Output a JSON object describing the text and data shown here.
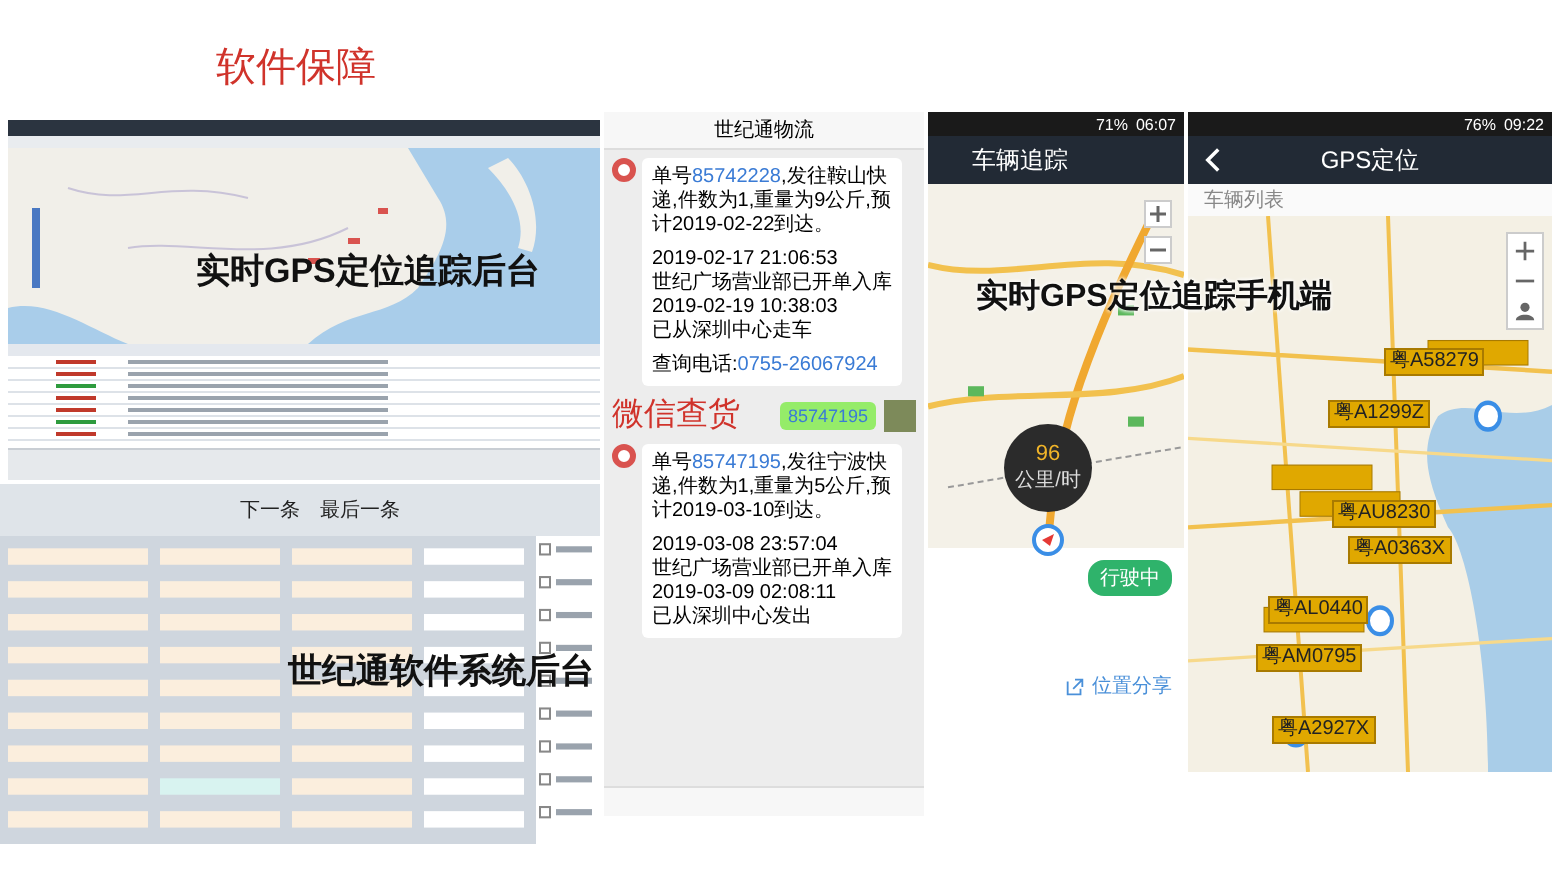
{
  "title": "软件保障",
  "gps_backend": {
    "caption": "实时GPS定位追踪后台"
  },
  "software_backend": {
    "caption": "世纪通软件系统后台",
    "toolbar": [
      "下一条",
      "最后一条"
    ]
  },
  "wechat": {
    "title": "世纪通物流",
    "caption": "微信查货",
    "query": "85747195",
    "messages": [
      {
        "blocks": [
          [
            [
              {
                "kind": "text",
                "text": "单号"
              },
              {
                "kind": "link",
                "text": "85742228"
              },
              {
                "kind": "text",
                "text": ",发往鞍山快递,件数为1,重量为9公斤,预计2019-02-22到达。"
              }
            ]
          ],
          [
            [
              {
                "kind": "text",
                "text": "2019-02-17 21:06:53"
              }
            ],
            [
              {
                "kind": "text",
                "text": "世纪广场营业部已开单入库"
              }
            ],
            [
              {
                "kind": "text",
                "text": "2019-02-19 10:38:03"
              }
            ],
            [
              {
                "kind": "text",
                "text": "已从深圳中心走车"
              }
            ]
          ],
          [
            [
              {
                "kind": "text",
                "text": "查询电话:"
              },
              {
                "kind": "link",
                "text": "0755-26067924"
              }
            ]
          ]
        ]
      },
      {
        "blocks": [
          [
            [
              {
                "kind": "text",
                "text": "单号"
              },
              {
                "kind": "link",
                "text": "85747195"
              },
              {
                "kind": "text",
                "text": ",发往宁波快递,件数为1,重量为5公斤,预计2019-03-10到达。"
              }
            ]
          ],
          [
            [
              {
                "kind": "text",
                "text": "2019-03-08 23:57:04"
              }
            ],
            [
              {
                "kind": "text",
                "text": "世纪广场营业部已开单入库"
              }
            ],
            [
              {
                "kind": "text",
                "text": "2019-03-09 02:08:11"
              }
            ],
            [
              {
                "kind": "text",
                "text": "已从深圳中心发出"
              }
            ]
          ]
        ]
      }
    ]
  },
  "tracking_phone": {
    "battery": "71%",
    "time": "06:07",
    "title": "车辆追踪",
    "speed": "96",
    "speed_unit": "公里/时",
    "status_badge": "行驶中",
    "share": "位置分享"
  },
  "mobile_caption": "实时GPS定位追踪手机端",
  "gps_phone": {
    "battery": "76%",
    "time": "09:22",
    "title": "GPS定位",
    "dropdown": "车辆列表",
    "plates": [
      "粤A58279",
      "粤A1299Z",
      "粤AU8230",
      "粤A0363X",
      "粤AL0440",
      "粤AM0795",
      "粤A2927X"
    ]
  }
}
